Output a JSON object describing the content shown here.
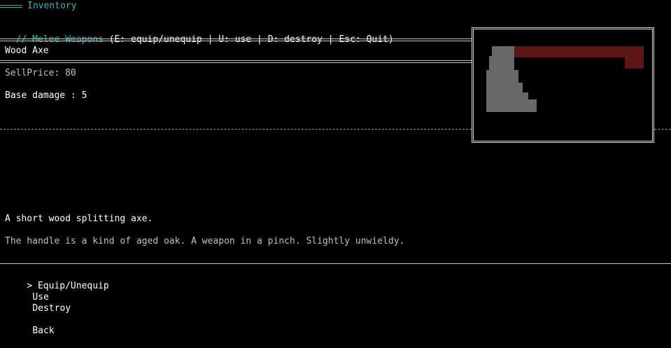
{
  "header": {
    "title": "Inventory",
    "category": "// Melee Weapons",
    "hotkeys": "(E: equip/unequip | U: use | D: destroy | Esc: Quit)"
  },
  "item": {
    "name": "Wood Axe",
    "sell_price": "SellPrice: 80",
    "base_damage": "Base damage : 5",
    "short_description": "A short wood splitting axe.",
    "long_description": "The handle is a kind of aged oak. A weapon in a pinch. Slightly unwieldy."
  },
  "preview": {
    "subject": "axe-ascii-art",
    "colors": {
      "handle": "#8a8a8a",
      "blade": "#7a1e1e"
    }
  },
  "menu": {
    "cursor": ">",
    "items": [
      {
        "label": "Equip/Unequip",
        "selected": true
      },
      {
        "label": "Use",
        "selected": false
      },
      {
        "label": "Destroy",
        "selected": false
      },
      {
        "label": "Back",
        "selected": false
      }
    ]
  },
  "colors": {
    "background": "#000000",
    "accent": "#3fb5b0",
    "text": "#ffffff",
    "muted_text": "#c0c0c0",
    "rule": "#c8c8c8"
  }
}
